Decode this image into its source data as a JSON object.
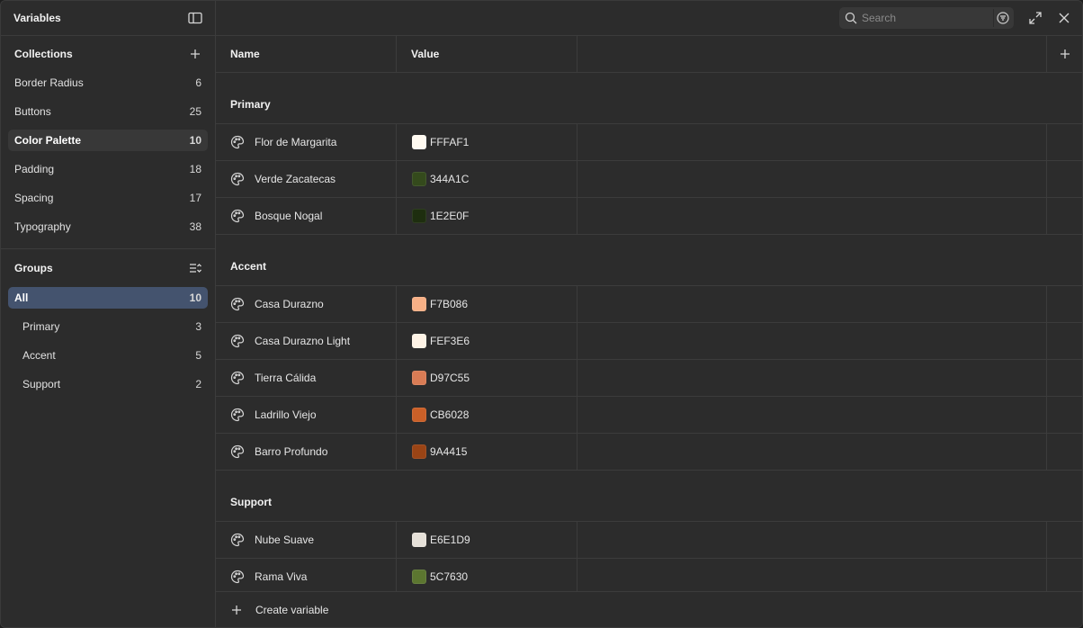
{
  "sidebar": {
    "title": "Variables",
    "collections_label": "Collections",
    "collections": [
      {
        "label": "Border Radius",
        "count": "6"
      },
      {
        "label": "Buttons",
        "count": "25"
      },
      {
        "label": "Color Palette",
        "count": "10",
        "selected": true
      },
      {
        "label": "Padding",
        "count": "18"
      },
      {
        "label": "Spacing",
        "count": "17"
      },
      {
        "label": "Typography",
        "count": "38"
      }
    ],
    "groups_label": "Groups",
    "groups": [
      {
        "label": "All",
        "count": "10",
        "active": true
      },
      {
        "label": "Primary",
        "count": "3"
      },
      {
        "label": "Accent",
        "count": "5"
      },
      {
        "label": "Support",
        "count": "2"
      }
    ]
  },
  "topbar": {
    "search_placeholder": "Search"
  },
  "table": {
    "col_name": "Name",
    "col_value": "Value"
  },
  "groups": [
    {
      "title": "Primary",
      "rows": [
        {
          "name": "Flor de Margarita",
          "value": "FFFAF1",
          "color": "#FFFAF1"
        },
        {
          "name": "Verde Zacatecas",
          "value": "344A1C",
          "color": "#344A1C"
        },
        {
          "name": "Bosque Nogal",
          "value": "1E2E0F",
          "color": "#1E2E0F"
        }
      ]
    },
    {
      "title": "Accent",
      "rows": [
        {
          "name": "Casa Durazno",
          "value": "F7B086",
          "color": "#F7B086"
        },
        {
          "name": "Casa Durazno Light",
          "value": "FEF3E6",
          "color": "#FEF3E6"
        },
        {
          "name": "Tierra Cálida",
          "value": "D97C55",
          "color": "#D97C55"
        },
        {
          "name": "Ladrillo Viejo",
          "value": "CB6028",
          "color": "#CB6028"
        },
        {
          "name": "Barro Profundo",
          "value": "9A4415",
          "color": "#9A4415"
        }
      ]
    },
    {
      "title": "Support",
      "rows": [
        {
          "name": "Nube Suave",
          "value": "E6E1D9",
          "color": "#E6E1D9"
        },
        {
          "name": "Rama Viva",
          "value": "5C7630",
          "color": "#5C7630"
        }
      ]
    }
  ],
  "footer": {
    "create_label": "Create variable"
  },
  "colors": {
    "background": "#2c2c2c",
    "accent_selection": "#44536e",
    "border": "#3c3c3c"
  }
}
